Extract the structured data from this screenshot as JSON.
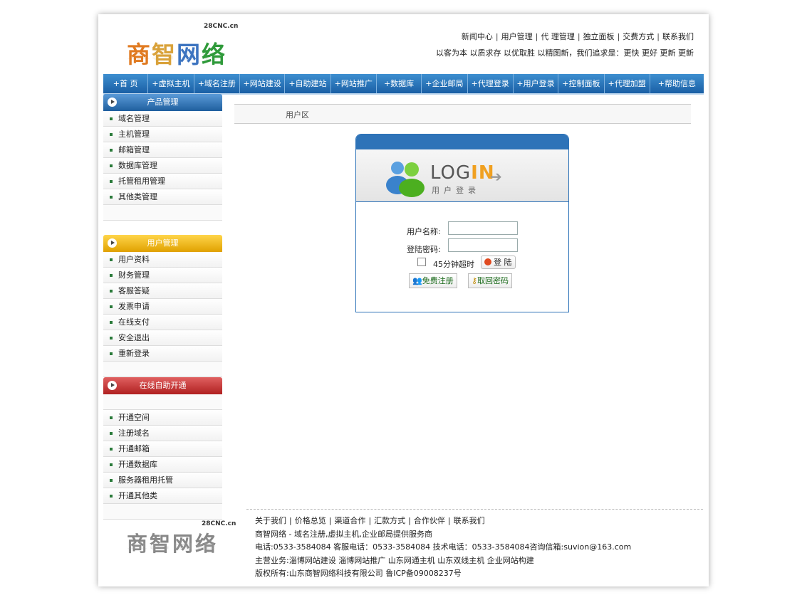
{
  "header": {
    "logo_domain": "28CNC.cn",
    "logo_chars": [
      "商",
      "智",
      "网",
      "络"
    ],
    "top_links": [
      "新闻中心",
      "用户管理",
      "代 理管理",
      "独立面板",
      "交费方式",
      "联系我们"
    ],
    "slogan": "以客为本  以质求存  以优取胜  以精图新，我们追求是：更快  更好  更新  更新"
  },
  "nav": [
    "+首 页",
    "+虚拟主机",
    "+域名注册",
    "+网站建设",
    "+自助建站",
    "+网站推广",
    "+数据库",
    "+企业邮局",
    "+代理登录",
    "+用户登录",
    "+控制面板",
    "+代理加盟",
    "+帮助信息"
  ],
  "sidebar": {
    "product": {
      "title": "产品管理",
      "items": [
        "域名管理",
        "主机管理",
        "邮箱管理",
        "数据库管理",
        "托管租用管理",
        "其他类管理"
      ]
    },
    "user": {
      "title": "用户管理",
      "items": [
        "用户资料",
        "财务管理",
        "客服答疑",
        "发票申请",
        "在线支付",
        "安全退出",
        "重新登录"
      ]
    },
    "online": {
      "title": "在线自助开通",
      "items": [
        "开通空间",
        "注册域名",
        "开通邮箱",
        "开通数据库",
        "服务器租用托管",
        "开通其他类"
      ]
    }
  },
  "main": {
    "breadcrumb": "用户区",
    "login": {
      "logo_text_a": "LOG",
      "logo_text_b": "IN",
      "logo_sub": "用户登录",
      "username_label": "用户名称:",
      "password_label": "登陆密码:",
      "username_value": "",
      "password_value": "",
      "timeout_label": "45分钟超时",
      "login_button": "登 陆",
      "register_button": "免费注册",
      "recover_button": "取回密码"
    }
  },
  "footer": {
    "links": [
      "关于我们",
      "价格总览",
      "渠道合作",
      "汇款方式",
      "合作伙伴",
      "联系我们"
    ],
    "line1": "商智网络 - 域名注册,虚拟主机,企业邮局提供服务商",
    "line2": "电话:0533-3584084 客服电话：0533-3584084 技术电话：0533-3584084咨询信箱:suvion@163.com",
    "line3": "主营业务:淄博网站建设  淄博网站推广  山东网通主机  山东双线主机  企业网站构建",
    "line4": "版权所有:山东商智网络科技有限公司 鲁ICP备09008237号"
  }
}
